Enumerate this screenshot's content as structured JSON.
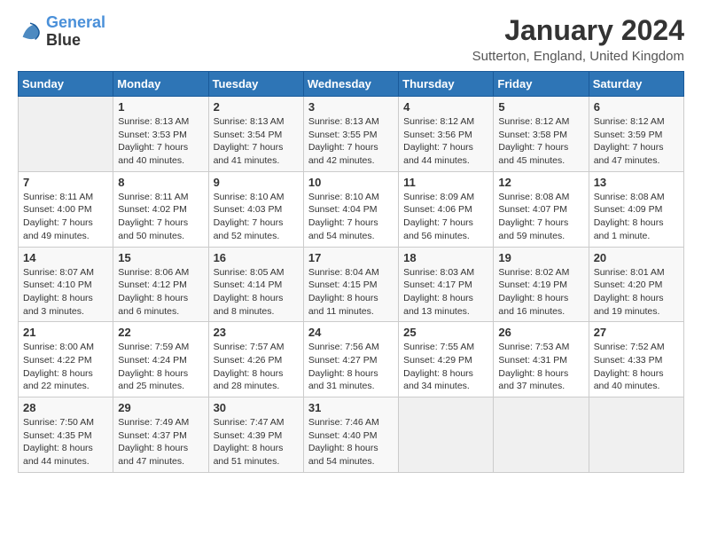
{
  "logo": {
    "line1": "General",
    "line2": "Blue"
  },
  "title": "January 2024",
  "subtitle": "Sutterton, England, United Kingdom",
  "days_of_week": [
    "Sunday",
    "Monday",
    "Tuesday",
    "Wednesday",
    "Thursday",
    "Friday",
    "Saturday"
  ],
  "weeks": [
    [
      {
        "day": "",
        "sunrise": "",
        "sunset": "",
        "daylight": ""
      },
      {
        "day": "1",
        "sunrise": "Sunrise: 8:13 AM",
        "sunset": "Sunset: 3:53 PM",
        "daylight": "Daylight: 7 hours and 40 minutes."
      },
      {
        "day": "2",
        "sunrise": "Sunrise: 8:13 AM",
        "sunset": "Sunset: 3:54 PM",
        "daylight": "Daylight: 7 hours and 41 minutes."
      },
      {
        "day": "3",
        "sunrise": "Sunrise: 8:13 AM",
        "sunset": "Sunset: 3:55 PM",
        "daylight": "Daylight: 7 hours and 42 minutes."
      },
      {
        "day": "4",
        "sunrise": "Sunrise: 8:12 AM",
        "sunset": "Sunset: 3:56 PM",
        "daylight": "Daylight: 7 hours and 44 minutes."
      },
      {
        "day": "5",
        "sunrise": "Sunrise: 8:12 AM",
        "sunset": "Sunset: 3:58 PM",
        "daylight": "Daylight: 7 hours and 45 minutes."
      },
      {
        "day": "6",
        "sunrise": "Sunrise: 8:12 AM",
        "sunset": "Sunset: 3:59 PM",
        "daylight": "Daylight: 7 hours and 47 minutes."
      }
    ],
    [
      {
        "day": "7",
        "sunrise": "Sunrise: 8:11 AM",
        "sunset": "Sunset: 4:00 PM",
        "daylight": "Daylight: 7 hours and 49 minutes."
      },
      {
        "day": "8",
        "sunrise": "Sunrise: 8:11 AM",
        "sunset": "Sunset: 4:02 PM",
        "daylight": "Daylight: 7 hours and 50 minutes."
      },
      {
        "day": "9",
        "sunrise": "Sunrise: 8:10 AM",
        "sunset": "Sunset: 4:03 PM",
        "daylight": "Daylight: 7 hours and 52 minutes."
      },
      {
        "day": "10",
        "sunrise": "Sunrise: 8:10 AM",
        "sunset": "Sunset: 4:04 PM",
        "daylight": "Daylight: 7 hours and 54 minutes."
      },
      {
        "day": "11",
        "sunrise": "Sunrise: 8:09 AM",
        "sunset": "Sunset: 4:06 PM",
        "daylight": "Daylight: 7 hours and 56 minutes."
      },
      {
        "day": "12",
        "sunrise": "Sunrise: 8:08 AM",
        "sunset": "Sunset: 4:07 PM",
        "daylight": "Daylight: 7 hours and 59 minutes."
      },
      {
        "day": "13",
        "sunrise": "Sunrise: 8:08 AM",
        "sunset": "Sunset: 4:09 PM",
        "daylight": "Daylight: 8 hours and 1 minute."
      }
    ],
    [
      {
        "day": "14",
        "sunrise": "Sunrise: 8:07 AM",
        "sunset": "Sunset: 4:10 PM",
        "daylight": "Daylight: 8 hours and 3 minutes."
      },
      {
        "day": "15",
        "sunrise": "Sunrise: 8:06 AM",
        "sunset": "Sunset: 4:12 PM",
        "daylight": "Daylight: 8 hours and 6 minutes."
      },
      {
        "day": "16",
        "sunrise": "Sunrise: 8:05 AM",
        "sunset": "Sunset: 4:14 PM",
        "daylight": "Daylight: 8 hours and 8 minutes."
      },
      {
        "day": "17",
        "sunrise": "Sunrise: 8:04 AM",
        "sunset": "Sunset: 4:15 PM",
        "daylight": "Daylight: 8 hours and 11 minutes."
      },
      {
        "day": "18",
        "sunrise": "Sunrise: 8:03 AM",
        "sunset": "Sunset: 4:17 PM",
        "daylight": "Daylight: 8 hours and 13 minutes."
      },
      {
        "day": "19",
        "sunrise": "Sunrise: 8:02 AM",
        "sunset": "Sunset: 4:19 PM",
        "daylight": "Daylight: 8 hours and 16 minutes."
      },
      {
        "day": "20",
        "sunrise": "Sunrise: 8:01 AM",
        "sunset": "Sunset: 4:20 PM",
        "daylight": "Daylight: 8 hours and 19 minutes."
      }
    ],
    [
      {
        "day": "21",
        "sunrise": "Sunrise: 8:00 AM",
        "sunset": "Sunset: 4:22 PM",
        "daylight": "Daylight: 8 hours and 22 minutes."
      },
      {
        "day": "22",
        "sunrise": "Sunrise: 7:59 AM",
        "sunset": "Sunset: 4:24 PM",
        "daylight": "Daylight: 8 hours and 25 minutes."
      },
      {
        "day": "23",
        "sunrise": "Sunrise: 7:57 AM",
        "sunset": "Sunset: 4:26 PM",
        "daylight": "Daylight: 8 hours and 28 minutes."
      },
      {
        "day": "24",
        "sunrise": "Sunrise: 7:56 AM",
        "sunset": "Sunset: 4:27 PM",
        "daylight": "Daylight: 8 hours and 31 minutes."
      },
      {
        "day": "25",
        "sunrise": "Sunrise: 7:55 AM",
        "sunset": "Sunset: 4:29 PM",
        "daylight": "Daylight: 8 hours and 34 minutes."
      },
      {
        "day": "26",
        "sunrise": "Sunrise: 7:53 AM",
        "sunset": "Sunset: 4:31 PM",
        "daylight": "Daylight: 8 hours and 37 minutes."
      },
      {
        "day": "27",
        "sunrise": "Sunrise: 7:52 AM",
        "sunset": "Sunset: 4:33 PM",
        "daylight": "Daylight: 8 hours and 40 minutes."
      }
    ],
    [
      {
        "day": "28",
        "sunrise": "Sunrise: 7:50 AM",
        "sunset": "Sunset: 4:35 PM",
        "daylight": "Daylight: 8 hours and 44 minutes."
      },
      {
        "day": "29",
        "sunrise": "Sunrise: 7:49 AM",
        "sunset": "Sunset: 4:37 PM",
        "daylight": "Daylight: 8 hours and 47 minutes."
      },
      {
        "day": "30",
        "sunrise": "Sunrise: 7:47 AM",
        "sunset": "Sunset: 4:39 PM",
        "daylight": "Daylight: 8 hours and 51 minutes."
      },
      {
        "day": "31",
        "sunrise": "Sunrise: 7:46 AM",
        "sunset": "Sunset: 4:40 PM",
        "daylight": "Daylight: 8 hours and 54 minutes."
      },
      {
        "day": "",
        "sunrise": "",
        "sunset": "",
        "daylight": ""
      },
      {
        "day": "",
        "sunrise": "",
        "sunset": "",
        "daylight": ""
      },
      {
        "day": "",
        "sunrise": "",
        "sunset": "",
        "daylight": ""
      }
    ]
  ]
}
